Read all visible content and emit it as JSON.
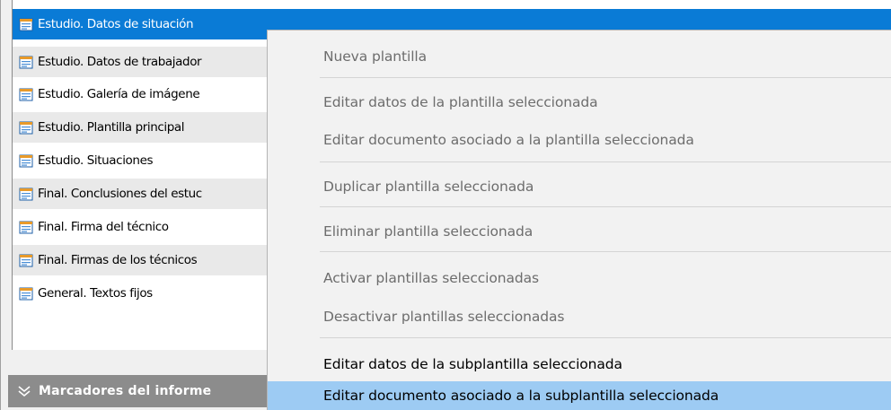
{
  "template_list": {
    "items": [
      {
        "label": "Estudio. Datos de situación",
        "icon": "document-icon",
        "selected": true
      },
      {
        "label": "Estudio. Datos de trabajador",
        "icon": "document-icon",
        "selected": false
      },
      {
        "label": "Estudio. Galería de imágene",
        "icon": "document-icon",
        "selected": false
      },
      {
        "label": "Estudio. Plantilla principal",
        "icon": "document-icon",
        "selected": false
      },
      {
        "label": "Estudio. Situaciones",
        "icon": "document-icon",
        "selected": false
      },
      {
        "label": "Final. Conclusiones del estuc",
        "icon": "document-icon",
        "selected": false
      },
      {
        "label": "Final. Firma del técnico",
        "icon": "document-icon",
        "selected": false
      },
      {
        "label": "Final. Firmas de los técnicos",
        "icon": "document-icon",
        "selected": false
      },
      {
        "label": "General. Textos fijos",
        "icon": "document-icon",
        "selected": false
      }
    ]
  },
  "bookmarks_section": {
    "label": "Marcadores del informe",
    "icon": "double-chevron-down-icon"
  },
  "context_menu": {
    "items": [
      {
        "label": "Nueva plantilla",
        "enabled": false,
        "hovered": false
      },
      {
        "label": "Editar datos de la plantilla seleccionada",
        "enabled": false,
        "hovered": false
      },
      {
        "label": "Editar documento asociado a la plantilla seleccionada",
        "enabled": false,
        "hovered": false
      },
      {
        "label": "Duplicar plantilla seleccionada",
        "enabled": false,
        "hovered": false
      },
      {
        "label": "Eliminar plantilla seleccionada",
        "enabled": false,
        "hovered": false
      },
      {
        "label": "Activar plantillas seleccionadas",
        "enabled": false,
        "hovered": false
      },
      {
        "label": "Desactivar plantillas seleccionadas",
        "enabled": false,
        "hovered": false
      },
      {
        "label": "Editar datos de la subplantilla seleccionada",
        "enabled": true,
        "hovered": false
      },
      {
        "label": "Editar documento asociado a la subplantilla seleccionada",
        "enabled": true,
        "hovered": true
      }
    ]
  },
  "colors": {
    "selection": "#0a7bd6",
    "menu_hover": "#9dcbf3",
    "menu_background": "#f2f2f2",
    "section_header": "#8c8c8c",
    "disabled_text": "#6d6d6d"
  }
}
